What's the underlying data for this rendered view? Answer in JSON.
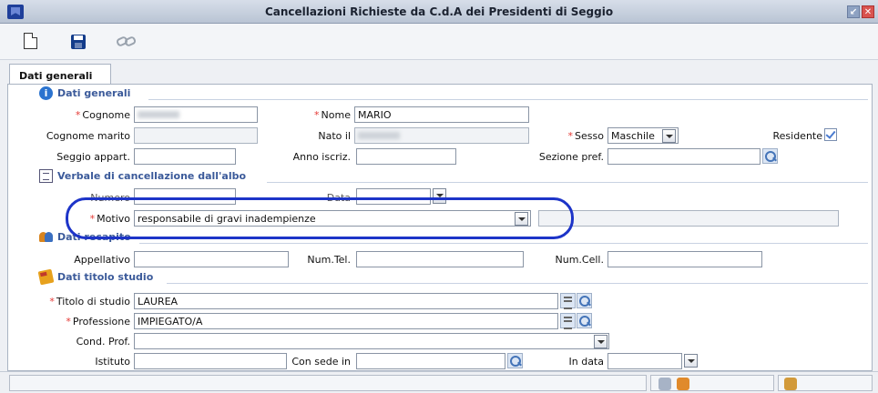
{
  "window": {
    "title": "Cancellazioni Richieste da C.d.A dei Presidenti di Seggio"
  },
  "toolbar": {
    "icons": [
      "new-document-icon",
      "save-icon",
      "link-icon"
    ]
  },
  "tabs": [
    {
      "label": "Dati generali",
      "active": true
    }
  ],
  "sections": {
    "dati_generali": "Dati generali",
    "verbale": "Verbale di cancellazione dall'albo",
    "recapito": "Dati recapito",
    "titolo_studio": "Dati titolo studio"
  },
  "required_mark": "*",
  "fields": {
    "cognome": {
      "label": "Cognome",
      "value": ""
    },
    "nome": {
      "label": "Nome",
      "value": "MARIO"
    },
    "cognome_marito": {
      "label": "Cognome marito",
      "value": ""
    },
    "nato_il": {
      "label": "Nato il",
      "value": ""
    },
    "sesso": {
      "label": "Sesso",
      "value": "Maschile"
    },
    "residente": {
      "label": "Residente",
      "checked": true
    },
    "seggio_appart": {
      "label": "Seggio appart.",
      "value": ""
    },
    "anno_iscriz": {
      "label": "Anno iscriz.",
      "value": ""
    },
    "sezione_pref": {
      "label": "Sezione pref.",
      "value": ""
    },
    "numero": {
      "label": "Numero",
      "value": ""
    },
    "data": {
      "label": "Data",
      "value": ""
    },
    "motivo": {
      "label": "Motivo",
      "value": "responsabile di gravi inadempienze"
    },
    "appellativo": {
      "label": "Appellativo",
      "value": ""
    },
    "num_tel": {
      "label": "Num.Tel.",
      "value": ""
    },
    "num_cell": {
      "label": "Num.Cell.",
      "value": ""
    },
    "titolo_studio": {
      "label": "Titolo di studio",
      "value": "LAUREA"
    },
    "professione": {
      "label": "Professione",
      "value": "IMPIEGATO/A"
    },
    "cond_prof": {
      "label": "Cond. Prof.",
      "value": ""
    },
    "istituto": {
      "label": "Istituto",
      "value": ""
    },
    "con_sede_in": {
      "label": "Con sede in",
      "value": ""
    },
    "in_data": {
      "label": "In data",
      "value": ""
    }
  },
  "colors": {
    "highlight": "#1d34c8",
    "required": "#e53935",
    "section_title": "#3b5a9a"
  }
}
